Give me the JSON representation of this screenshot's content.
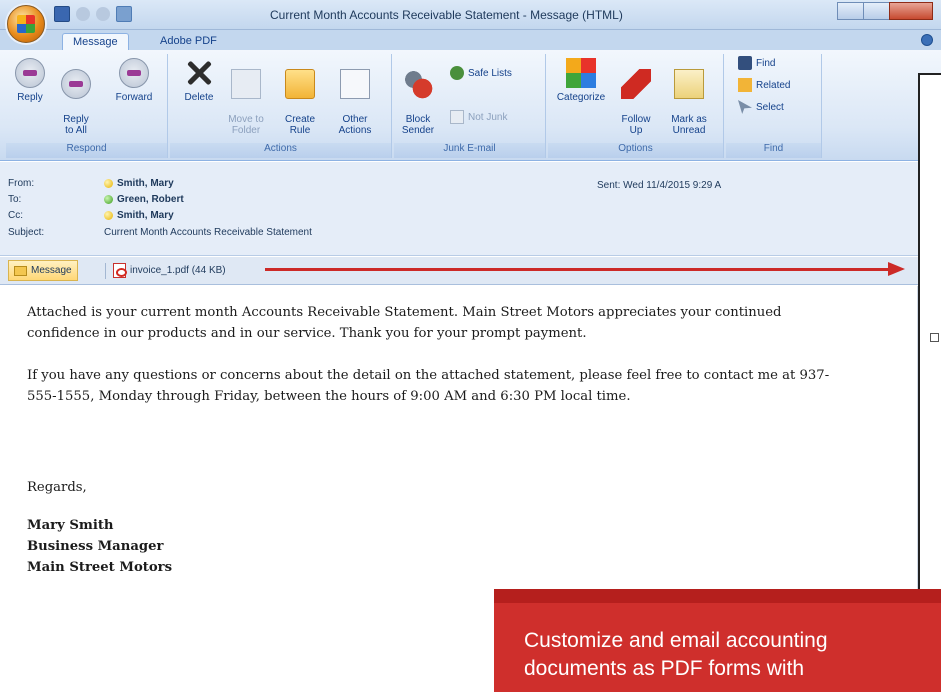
{
  "window": {
    "title": "Current Month Accounts Receivable Statement - Message (HTML)"
  },
  "ribbon": {
    "tabs": [
      {
        "label": "Message",
        "active": true
      },
      {
        "label": "Adobe PDF",
        "active": false
      }
    ],
    "groups": {
      "respond": {
        "label": "Respond",
        "buttons": [
          {
            "label": "Reply",
            "icon": "reply-icon"
          },
          {
            "label": "Reply\nto All",
            "icon": "reply-all-icon"
          },
          {
            "label": "Forward",
            "icon": "forward-icon"
          }
        ]
      },
      "actions": {
        "label": "Actions",
        "buttons": [
          {
            "label": "Delete",
            "icon": "delete-icon"
          },
          {
            "label": "Move to\nFolder",
            "icon": "move-to-folder-icon",
            "disabled": true
          },
          {
            "label": "Create\nRule",
            "icon": "create-rule-icon"
          },
          {
            "label": "Other\nActions",
            "icon": "other-actions-icon"
          }
        ]
      },
      "junk": {
        "label": "Junk E-mail",
        "block_sender": "Block\nSender",
        "safe_lists": "Safe Lists",
        "not_junk": "Not Junk"
      },
      "options": {
        "label": "Options",
        "buttons": [
          {
            "label": "Categorize",
            "icon": "categorize-icon"
          },
          {
            "label": "Follow\nUp",
            "icon": "flag-icon"
          },
          {
            "label": "Mark as\nUnread",
            "icon": "mark-unread-icon"
          }
        ]
      },
      "find": {
        "label": "Find",
        "find": "Find",
        "related": "Related",
        "select": "Select"
      }
    }
  },
  "message": {
    "from_label": "From:",
    "from": "Smith, Mary",
    "to_label": "To:",
    "to": "Green, Robert",
    "cc_label": "Cc:",
    "cc": "Smith, Mary",
    "subject_label": "Subject:",
    "subject": "Current Month Accounts Receivable Statement",
    "sent": "Sent:  Wed 11/4/2015 9:29 A"
  },
  "attachments": {
    "message_tab": "Message",
    "file": "invoice_1.pdf (44 KB)"
  },
  "body": {
    "para1_line1": "Attached is your current month Accounts Receivable Statement. Main Street Motors appreciates your continued",
    "para1_line2": "confidence in our products and in our service. Thank you for your prompt payment.",
    "para2_line1": "If you have any questions or concerns about the detail on the attached statement, please feel free to contact me at 937-",
    "para2_line2": "555-1555, Monday through Friday, between the hours of 9:00 AM and 6:30 PM local time.",
    "regards": "Regards,",
    "sig_name": "Mary Smith",
    "sig_title": "Business Manager",
    "sig_company": "Main Street Motors"
  },
  "callout": {
    "line1": "Customize and email accounting",
    "line2": "documents as PDF forms with"
  },
  "colors": {
    "callout": "#cf2f2c",
    "arrow": "#cc2a27"
  }
}
